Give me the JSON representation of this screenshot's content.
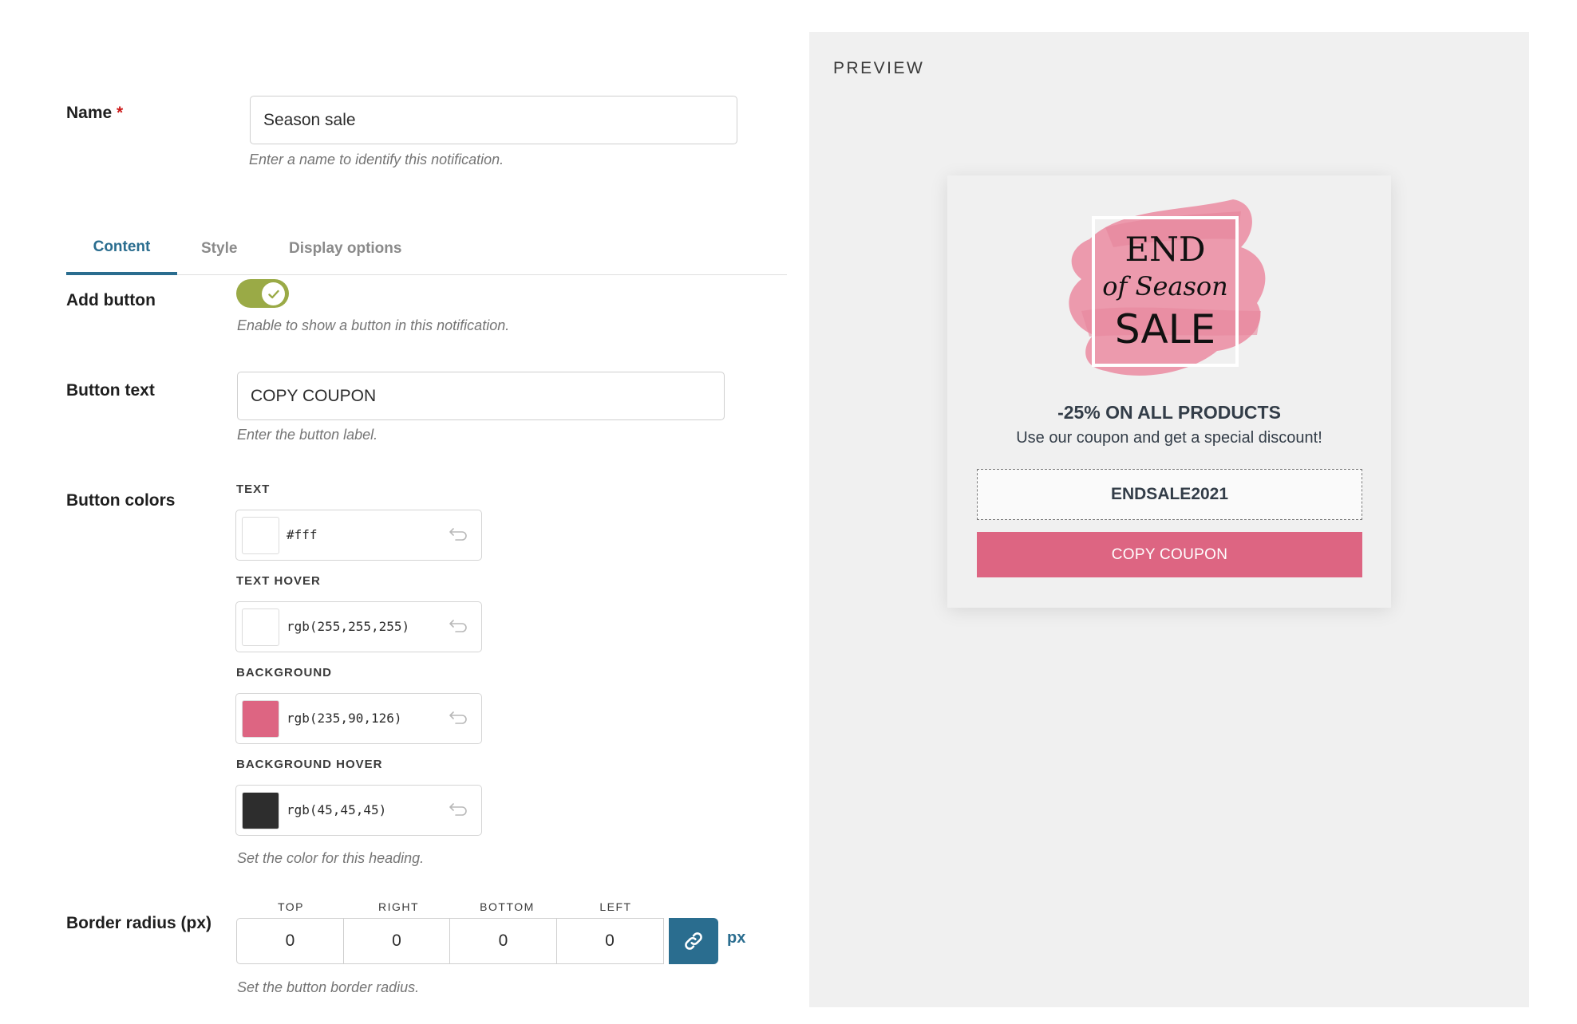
{
  "name_field": {
    "label": "Name",
    "required_mark": "*",
    "value": "Season sale",
    "help": "Enter a name to identify this notification."
  },
  "tabs": [
    {
      "label": "Content",
      "active": true
    },
    {
      "label": "Style",
      "active": false
    },
    {
      "label": "Display options",
      "active": false
    }
  ],
  "add_button": {
    "label": "Add button",
    "enabled": true,
    "help": "Enable to show a button in this notification."
  },
  "button_text": {
    "label": "Button text",
    "value": "COPY COUPON",
    "help": "Enter the button label."
  },
  "button_colors": {
    "label": "Button colors",
    "fields": [
      {
        "label": "TEXT",
        "value": "#fff",
        "swatch": "#ffffff"
      },
      {
        "label": "TEXT HOVER",
        "value": "rgb(255,255,255)",
        "swatch": "#ffffff"
      },
      {
        "label": "BACKGROUND",
        "value": "rgb(235,90,126)",
        "swatch": "#dd6582"
      },
      {
        "label": "BACKGROUND HOVER",
        "value": "rgb(45,45,45)",
        "swatch": "#2d2d2d"
      }
    ],
    "help": "Set the color for this heading."
  },
  "border_radius": {
    "label": "Border radius (px)",
    "sides": [
      {
        "label": "TOP",
        "value": "0"
      },
      {
        "label": "RIGHT",
        "value": "0"
      },
      {
        "label": "BOTTOM",
        "value": "0"
      },
      {
        "label": "LEFT",
        "value": "0"
      }
    ],
    "unit": "px",
    "link_icon": "link-icon",
    "help": "Set the button border radius."
  },
  "preview": {
    "title": "PREVIEW",
    "image_text": {
      "line1": "END",
      "line2": "of Season",
      "line3": "SALE"
    },
    "headline": "-25% ON ALL PRODUCTS",
    "subline": "Use our coupon and get a special discount!",
    "coupon_code": "ENDSALE2021",
    "button_label": "COPY COUPON"
  },
  "colors": {
    "accent": "#2a6d8f",
    "toggle_on": "#9aaa46",
    "cta": "#dd6582",
    "preview_bg": "#f0f0f0"
  }
}
